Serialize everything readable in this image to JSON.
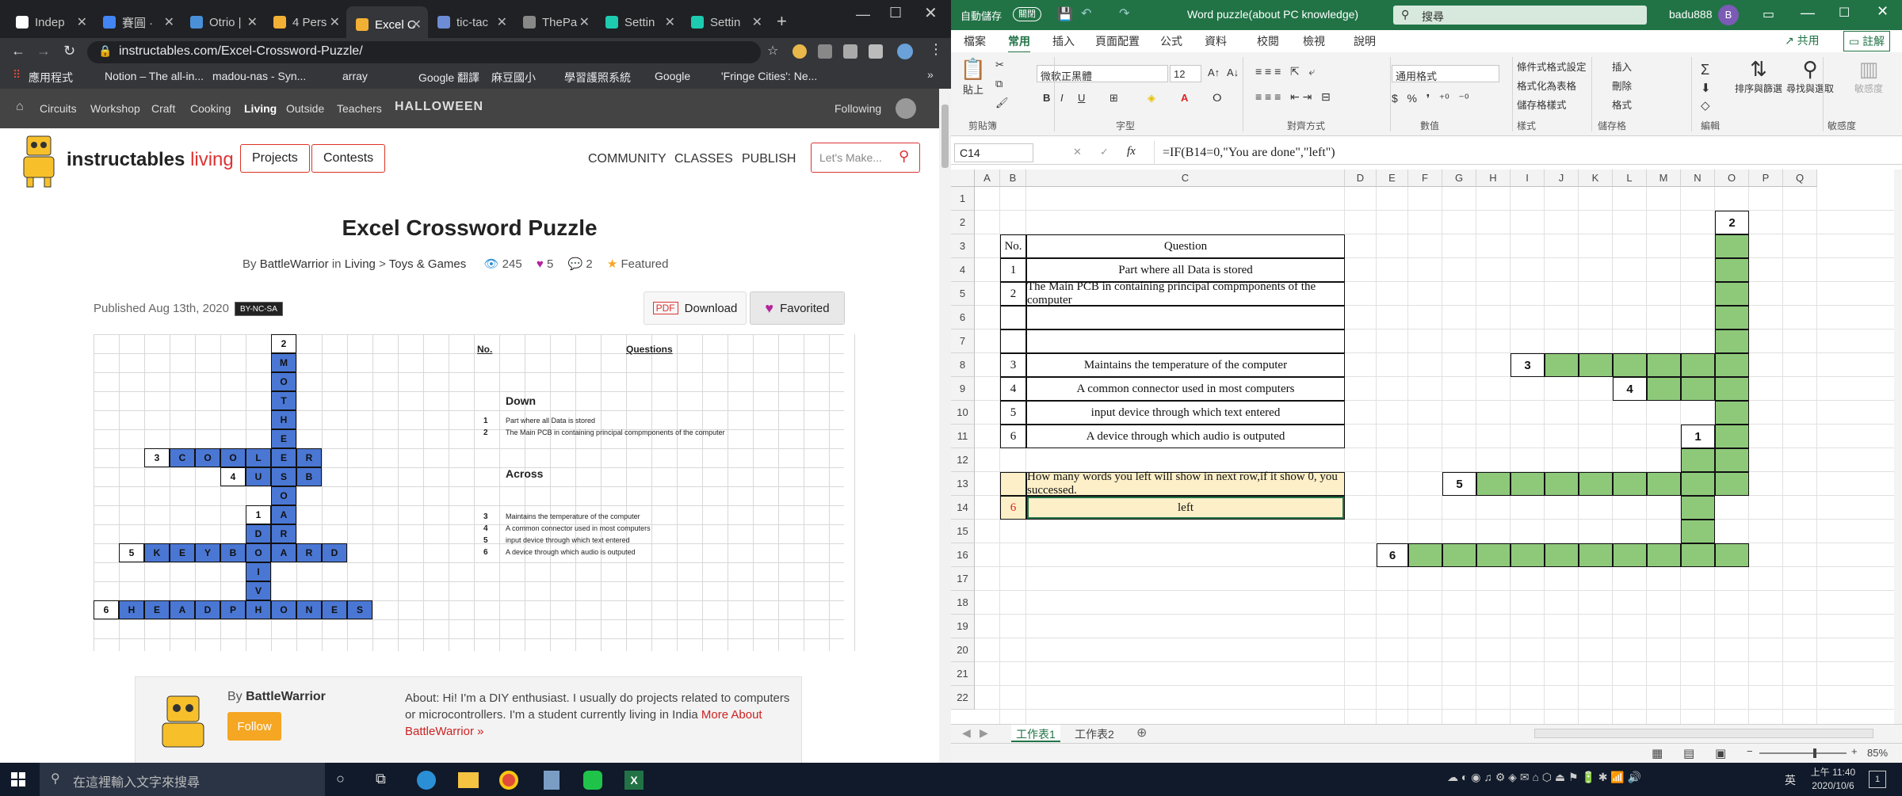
{
  "browser": {
    "tabs": [
      {
        "label": "Indep",
        "color": "#ffffff"
      },
      {
        "label": "賽圓 ·",
        "color": "#4285f4"
      },
      {
        "label": "Otrio |",
        "color": "#4a90d9"
      },
      {
        "label": "4 Pers",
        "color": "#f2b134"
      },
      {
        "label": "Excel C",
        "color": "#f2b134"
      },
      {
        "label": "tic-tac",
        "color": "#6c8cd5"
      },
      {
        "label": "ThePa",
        "color": "#888888"
      },
      {
        "label": "Settin",
        "color": "#1dcbb0"
      },
      {
        "label": "Settin",
        "color": "#1dcbb0"
      }
    ],
    "url": "instructables.com/Excel-Crossword-Puzzle/",
    "bookmarks": [
      "應用程式",
      "Notion – The all-in...",
      "madou-nas - Syn...",
      "array",
      "Google 翻譯",
      "麻豆國小",
      "學習護照系統",
      "Google",
      "'Fringe Cities': Ne..."
    ]
  },
  "site": {
    "nav": [
      "Circuits",
      "Workshop",
      "Craft",
      "Cooking",
      "Living",
      "Outside",
      "Teachers"
    ],
    "halloween": "HALLOWEEN",
    "following": "Following",
    "logo": "instructables",
    "logo_sub": "living",
    "projects": "Projects",
    "contests": "Contests",
    "links": [
      "COMMUNITY",
      "CLASSES",
      "PUBLISH"
    ],
    "search_placeholder": "Let's Make...",
    "title": "Excel Crossword Puzzle",
    "by": "By",
    "author": "BattleWarrior",
    "in": "in",
    "cat1": "Living",
    "sep": ">",
    "cat2": "Toys & Games",
    "views": "245",
    "likes": "5",
    "comments": "2",
    "featured": "Featured",
    "published": "Published Aug 13th, 2020",
    "license": "BY-NC-SA",
    "download": "Download",
    "favorited": "Favorited",
    "author_card": {
      "by": "By",
      "name": "BattleWarrior",
      "follow": "Follow",
      "about": "About: Hi! I'm a DIY enthusiast. I usually do projects related to computers or microcontrollers. I'm a student currently living in India",
      "more": "More About BattleWarrior »"
    }
  },
  "crossword_image": {
    "no_header": "No.",
    "q_header": "Questions",
    "down": "Down",
    "across": "Across",
    "clues": [
      {
        "n": "1",
        "t": "Part where all Data is stored"
      },
      {
        "n": "2",
        "t": "The Main PCB in containing principal compmponents of the computer"
      },
      {
        "n": "3",
        "t": "Maintains the temperature of the computer"
      },
      {
        "n": "4",
        "t": "A common connector used in most computers"
      },
      {
        "n": "5",
        "t": "input device through which text entered"
      },
      {
        "n": "6",
        "t": "A device through which audio is outputed"
      }
    ]
  },
  "excel": {
    "autosave": "自動儲存",
    "autosave_state": "關閉",
    "doc_title": "Word puzzle(about PC knowledge)",
    "search": "搜尋",
    "user": "badu888",
    "user_initial": "B",
    "tabs": [
      "檔案",
      "常用",
      "插入",
      "頁面配置",
      "公式",
      "資料",
      "校閱",
      "檢視",
      "說明"
    ],
    "share": "共用",
    "comment": "註解",
    "font": "微軟正黑體",
    "font_size": "12",
    "number_format": "通用格式",
    "groups": [
      "剪貼簿",
      "字型",
      "對齊方式",
      "數值",
      "樣式",
      "儲存格",
      "編輯",
      "敏感度"
    ],
    "paste": "貼上",
    "styles": [
      "條件式格式設定",
      "格式化為表格",
      "儲存格樣式"
    ],
    "cells_btns": [
      "插入",
      "刪除",
      "格式"
    ],
    "edit_btns": [
      "排序與篩選",
      "尋找與選取"
    ],
    "sensitivity": "敏感度",
    "namebox": "C14",
    "formula": "=IF(B14=0,\"You are done\",\"left\")",
    "columns": [
      "A",
      "B",
      "C",
      "D",
      "E",
      "F",
      "G",
      "H",
      "I",
      "J",
      "K",
      "L",
      "M",
      "N",
      "O",
      "P",
      "Q"
    ],
    "rows": [
      "1",
      "2",
      "3",
      "4",
      "5",
      "6",
      "7",
      "8",
      "9",
      "10",
      "11",
      "12",
      "13",
      "14",
      "15",
      "16",
      "17",
      "18",
      "19",
      "20",
      "21",
      "22"
    ],
    "table_header": {
      "no": "No.",
      "q": "Question"
    },
    "table_rows": [
      {
        "no": "1",
        "q": "Part where all Data is stored"
      },
      {
        "no": "2",
        "q": "The Main PCB in containing principal compmponents of the computer"
      },
      {
        "no": "",
        "q": ""
      },
      {
        "no": "",
        "q": ""
      },
      {
        "no": "3",
        "q": "Maintains the temperature of the computer"
      },
      {
        "no": "4",
        "q": "A common connector used in most computers"
      },
      {
        "no": "5",
        "q": "input device through which text entered"
      },
      {
        "no": "6",
        "q": "A device through which audio is outputed"
      }
    ],
    "count_label": "How many words you left will show in next row,if it show 0, you successed.",
    "count_value": "6",
    "count_text": "left",
    "sheets": [
      "工作表1",
      "工作表2"
    ],
    "zoom": "85%"
  },
  "taskbar": {
    "search": "在這裡輸入文字來搜尋",
    "ime": "英",
    "time": "上午 11:40",
    "date": "2020/10/6",
    "notif": "1"
  }
}
